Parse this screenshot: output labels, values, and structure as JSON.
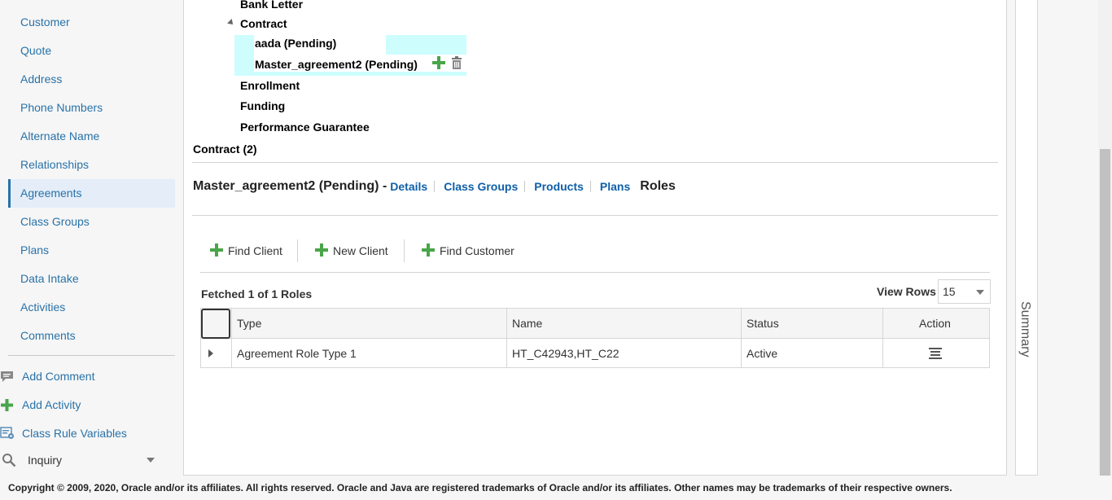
{
  "sidebar": {
    "items": [
      {
        "label": "Customer"
      },
      {
        "label": "Quote"
      },
      {
        "label": "Address"
      },
      {
        "label": "Phone Numbers"
      },
      {
        "label": "Alternate Name"
      },
      {
        "label": "Relationships"
      },
      {
        "label": "Agreements"
      },
      {
        "label": "Class Groups"
      },
      {
        "label": "Plans"
      },
      {
        "label": "Data Intake"
      },
      {
        "label": "Activities"
      },
      {
        "label": "Comments"
      }
    ],
    "active": "Agreements",
    "actions": [
      {
        "label": "Add Comment",
        "icon": "comment-icon"
      },
      {
        "label": "Add Activity",
        "icon": "plus-icon"
      },
      {
        "label": "Class Rule Variables",
        "icon": "variables-icon"
      }
    ],
    "inquiry": {
      "label": "Inquiry",
      "icon": "search-icon"
    }
  },
  "tree": {
    "bank_letter": "Bank Letter",
    "contract": "Contract",
    "contract_children": [
      {
        "label": "aada (Pending)"
      },
      {
        "label": "Master_agreement2 (Pending)"
      }
    ],
    "enrollment": "Enrollment",
    "funding": "Funding",
    "performance_guarantee": "Performance Guarantee",
    "contract_count": "Contract (2)"
  },
  "agreement": {
    "title": "Master_agreement2 (Pending) -",
    "tabs": [
      {
        "label": "Details"
      },
      {
        "label": "Class Groups"
      },
      {
        "label": "Products"
      },
      {
        "label": "Plans"
      }
    ],
    "current_tab": "Roles"
  },
  "toolbar": {
    "find_client": "Find Client",
    "new_client": "New Client",
    "find_customer": "Find Customer"
  },
  "roles": {
    "fetched": "Fetched 1 of 1 Roles",
    "view_rows_label": "View Rows",
    "view_rows_value": "15",
    "columns": {
      "type": "Type",
      "name": "Name",
      "status": "Status",
      "action": "Action"
    },
    "rows": [
      {
        "type": "Agreement Role Type 1",
        "name": "HT_C42943,HT_C22",
        "status": "Active"
      }
    ]
  },
  "summary": {
    "label": "Summary"
  },
  "footer": {
    "text": "Copyright © 2009, 2020, Oracle and/or its affiliates. All rights reserved. Oracle and Java are registered trademarks of Oracle and/or its affiliates. Other names may be trademarks of their respective owners."
  },
  "colors": {
    "link": "#0f5fa8",
    "selection": "#cdfdfd",
    "plus": "#4aa54a"
  }
}
